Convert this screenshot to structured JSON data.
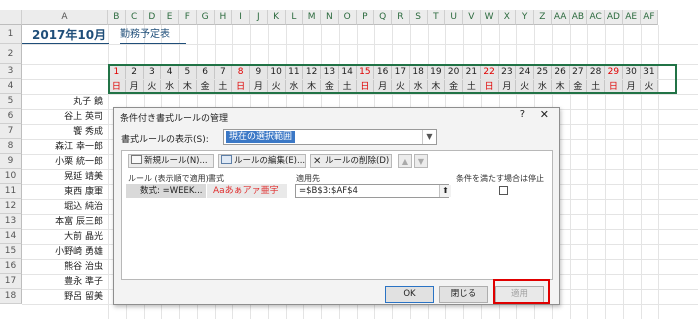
{
  "columns": [
    "A",
    "B",
    "C",
    "D",
    "E",
    "F",
    "G",
    "H",
    "I",
    "J",
    "K",
    "L",
    "M",
    "N",
    "O",
    "P",
    "Q",
    "R",
    "S",
    "T",
    "U",
    "V",
    "W",
    "X",
    "Y",
    "Z",
    "AA",
    "AB",
    "AC",
    "AD",
    "AE",
    "AF"
  ],
  "row_numbers": [
    "1",
    "2",
    "3",
    "4",
    "5",
    "6",
    "7",
    "8",
    "9",
    "10",
    "11",
    "12",
    "13",
    "14",
    "15",
    "16",
    "17",
    "18"
  ],
  "sheet": {
    "title": "2017年10月",
    "subtitle": "勤務予定表"
  },
  "days": [
    "1",
    "2",
    "3",
    "4",
    "5",
    "6",
    "7",
    "8",
    "9",
    "10",
    "11",
    "12",
    "13",
    "14",
    "15",
    "16",
    "17",
    "18",
    "19",
    "20",
    "21",
    "22",
    "23",
    "24",
    "25",
    "26",
    "27",
    "28",
    "29",
    "30",
    "31"
  ],
  "weekdays": [
    "日",
    "月",
    "火",
    "水",
    "木",
    "金",
    "土",
    "日",
    "月",
    "火",
    "水",
    "木",
    "金",
    "土",
    "日",
    "月",
    "火",
    "水",
    "木",
    "金",
    "土",
    "日",
    "月",
    "火",
    "水",
    "木",
    "金",
    "土",
    "日",
    "月",
    "火"
  ],
  "red_days": [
    0,
    7,
    14,
    21,
    28
  ],
  "names": [
    "丸子 饒",
    "谷上 英司",
    "饗 秀成",
    "森江 幸一郎",
    "小栗 統一郎",
    "晃延 靖美",
    "東西 康軍",
    "堀込 純治",
    "本富 辰三郎",
    "大前 晶光",
    "小野崎 勇雄",
    "熊谷 治虫",
    "豊永 準子",
    "野呂 留美"
  ],
  "dialog": {
    "title": "条件付き書式ルールの管理",
    "help": "?",
    "close": "✕",
    "show_label": "書式ルールの表示(S):",
    "show_value": "現在の選択範囲",
    "toolbar": {
      "new_rule": "新規ルール(N)...",
      "edit_rule": "ルールの編集(E)...",
      "delete_rule": "ルールの削除(D)"
    },
    "headers": {
      "rule": "ルール (表示順で適用)",
      "format": "書式",
      "applies_to": "適用先",
      "stop_if_true": "条件を満たす場合は停止"
    },
    "rule": {
      "name": "数式: =WEEK...",
      "format_preview": "Aaあぁアァ亜宇",
      "applies_to": "=$B$3:$AF$4"
    },
    "buttons": {
      "ok": "OK",
      "close": "閉じる",
      "apply": "適用"
    }
  },
  "colors": {
    "accent": "#217346",
    "title": "#1f4e79",
    "weekend_red": "#e00000",
    "selection_blue": "#3b78c6",
    "highlight_box": "#e00000"
  }
}
